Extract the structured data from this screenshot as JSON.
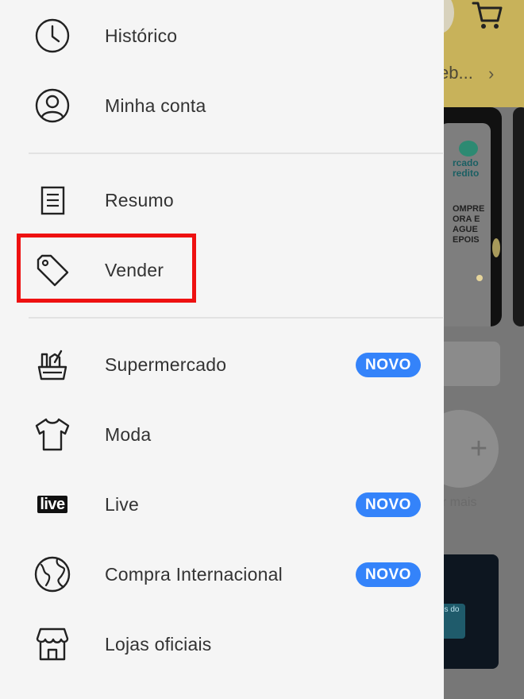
{
  "background": {
    "address_text": "eb...",
    "address_arrow": "›",
    "banner_brand": "rcado redito",
    "banner_promo": "OMPRE ORA E AGUE EPOIS",
    "plus_symbol": "+",
    "more_text": "er mais",
    "promo_tag_text": "os do"
  },
  "drawer": {
    "items": [
      {
        "label": "Histórico",
        "icon": "clock-icon"
      },
      {
        "label": "Minha conta",
        "icon": "user-icon"
      },
      {
        "label": "Resumo",
        "icon": "document-icon"
      },
      {
        "label": "Vender",
        "icon": "tag-icon"
      },
      {
        "label": "Supermercado",
        "icon": "basket-icon",
        "badge": "NOVO"
      },
      {
        "label": "Moda",
        "icon": "shirt-icon"
      },
      {
        "label": "Live",
        "icon": "live-icon",
        "icon_text": "live",
        "badge": "NOVO"
      },
      {
        "label": "Compra Internacional",
        "icon": "globe-icon",
        "badge": "NOVO"
      },
      {
        "label": "Lojas oficiais",
        "icon": "store-icon"
      }
    ]
  },
  "colors": {
    "badge": "#3483fa",
    "highlight": "#ee1111",
    "drawer_bg": "#f5f5f5",
    "overlay": "#777777"
  }
}
